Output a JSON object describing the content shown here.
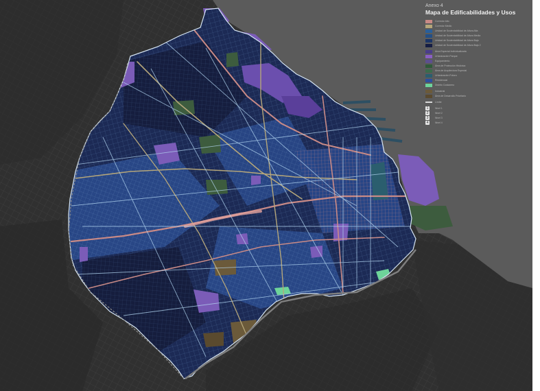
{
  "legend": {
    "annex": "Anexo 4",
    "title": "Mapa de Edificabilidades y Usos",
    "items": [
      {
        "color": "#c98a86",
        "label": "Corredor Alto",
        "kind": "fill"
      },
      {
        "color": "#b5a67a",
        "label": "Corredor Medio",
        "kind": "fill"
      },
      {
        "color": "#2a5f9a",
        "label": "Unidad de Sustentabilidad de Altura Alta",
        "kind": "fill"
      },
      {
        "color": "#244f86",
        "label": "Unidad de Sustentabilidad de Altura Media",
        "kind": "fill"
      },
      {
        "color": "#1b3566",
        "label": "Unidad de Sustentabilidad de Altura Baja",
        "kind": "fill"
      },
      {
        "color": "#141d44",
        "label": "Unidad de Sustentabilidad de Altura Baja 2",
        "kind": "fill"
      },
      {
        "color": "#4a3d8a",
        "label": "Área Especial Individualizada",
        "kind": "fill",
        "gap": true
      },
      {
        "color": "#8a5fc4",
        "label": "Urbanización Parque",
        "kind": "fill"
      },
      {
        "color": "#5d4f8f",
        "label": "Equipamiento",
        "kind": "fill"
      },
      {
        "color": "#2f5a3a",
        "label": "Área de Protección Histórica",
        "kind": "fill"
      },
      {
        "color": "#3c6b4c",
        "label": "Área de Arquitectura Especial",
        "kind": "fill"
      },
      {
        "color": "#2b5e6e",
        "label": "Urbanización Futura",
        "kind": "fill"
      },
      {
        "color": "#2d4f9e",
        "label": "Residencial",
        "kind": "fill"
      },
      {
        "color": "#6ed49a",
        "label": "Distrito Costanero",
        "kind": "fill"
      },
      {
        "color": "#6b5a3a",
        "label": "Industrial",
        "kind": "fill",
        "gap": true
      },
      {
        "color": "#5a4a2e",
        "label": "Área de Desarrollo Prioritario",
        "kind": "fill"
      },
      {
        "color": "#d8d8d8",
        "label": "Límite",
        "kind": "line",
        "gap": true
      },
      {
        "color": "#e5e5e5",
        "label": "Nivel 1",
        "kind": "num",
        "num": "1",
        "gap": true
      },
      {
        "color": "#e5e5e5",
        "label": "Nivel 2",
        "kind": "num",
        "num": "2"
      },
      {
        "color": "#e5e5e5",
        "label": "Nivel 3",
        "kind": "num",
        "num": "3"
      },
      {
        "color": "#e5e5e5",
        "label": "Nivel 4",
        "kind": "num",
        "num": "4"
      }
    ]
  },
  "colors": {
    "background": "#3a3a3a",
    "surroundings": "#2f2f2f",
    "river": "#5c5c5c",
    "city_base": "#1e2a52",
    "block_light": "#2d4a8c",
    "block_dark": "#161d3e",
    "park": "#7b5cb8",
    "green": "#3d5c3e",
    "corridor_high": "#c98a86",
    "corridor_med": "#b5a67a",
    "street": "#9ec7e8"
  }
}
